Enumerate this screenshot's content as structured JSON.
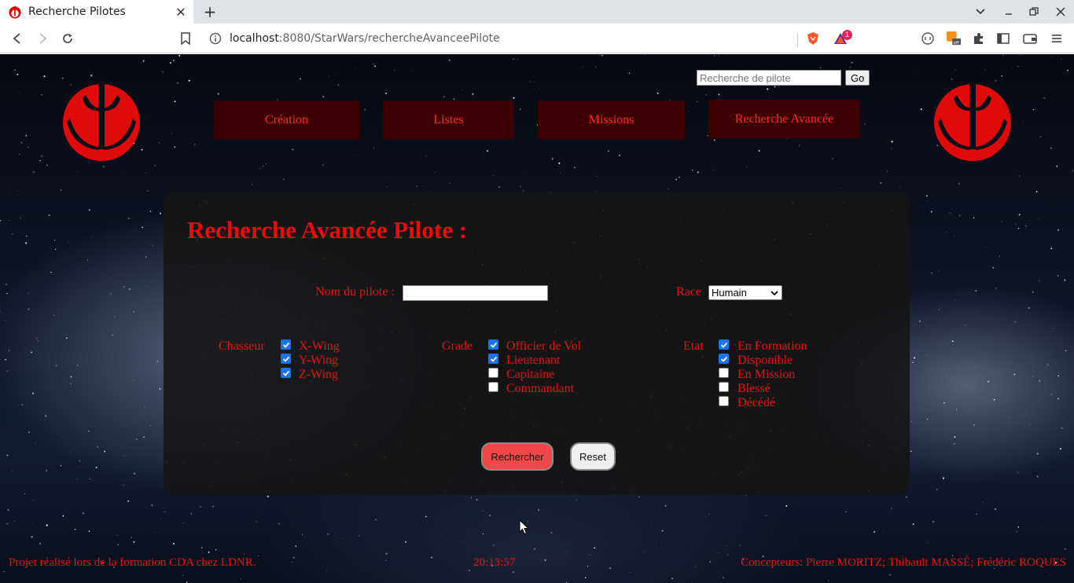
{
  "browser": {
    "tab_title": "Recherche Pilotes",
    "url_host": "localhost",
    "url_rest": ":8080/StarWars/rechercheAvanceePilote",
    "brave_badge": "1",
    "icons": [
      "back-icon",
      "forward-icon",
      "reload-icon",
      "bookmark-icon",
      "info-icon",
      "brave-shields-icon",
      "brave-rewards-icon",
      "wallet-icon",
      "extensions-icon",
      "sidebar-icon",
      "menu-icon"
    ]
  },
  "header": {
    "search_placeholder": "Recherche de pilote",
    "go_label": "Go",
    "nav": [
      "Création",
      "Listes",
      "Missions",
      "Recherche Avancée"
    ]
  },
  "form": {
    "title": "Recherche Avancée Pilote :",
    "name_label": "Nom du pilote :",
    "name_value": "",
    "race_label": "Race",
    "race_value": "Humain",
    "chasseur_label": "Chasseur",
    "chasseurs": [
      {
        "label": "X-Wing",
        "checked": true
      },
      {
        "label": "Y-Wing",
        "checked": true
      },
      {
        "label": "Z-Wing",
        "checked": true
      }
    ],
    "grade_label": "Grade",
    "grades": [
      {
        "label": "Officier de Vol",
        "checked": true
      },
      {
        "label": "Lieutenant",
        "checked": true
      },
      {
        "label": "Capitaine",
        "checked": false
      },
      {
        "label": "Commandant",
        "checked": false
      }
    ],
    "etat_label": "Etat",
    "etats": [
      {
        "label": "En Formation",
        "checked": true
      },
      {
        "label": "Disponible",
        "checked": true
      },
      {
        "label": "En Mission",
        "checked": false
      },
      {
        "label": "Blessé",
        "checked": false
      },
      {
        "label": "Décédé",
        "checked": false
      }
    ],
    "submit_label": "Rechercher",
    "reset_label": "Reset"
  },
  "footer": {
    "left": "Projet réalisé lors de la formation CDA chez LDNR.",
    "time": "20:13:57",
    "right": "Concepteurs: Pierre MORITZ; Thibault MASSÉ; Frédéric ROQUES"
  },
  "colors": {
    "accent_red": "#e8120e",
    "nav_bg": "#3d0104",
    "submit_bg": "#f04848"
  }
}
